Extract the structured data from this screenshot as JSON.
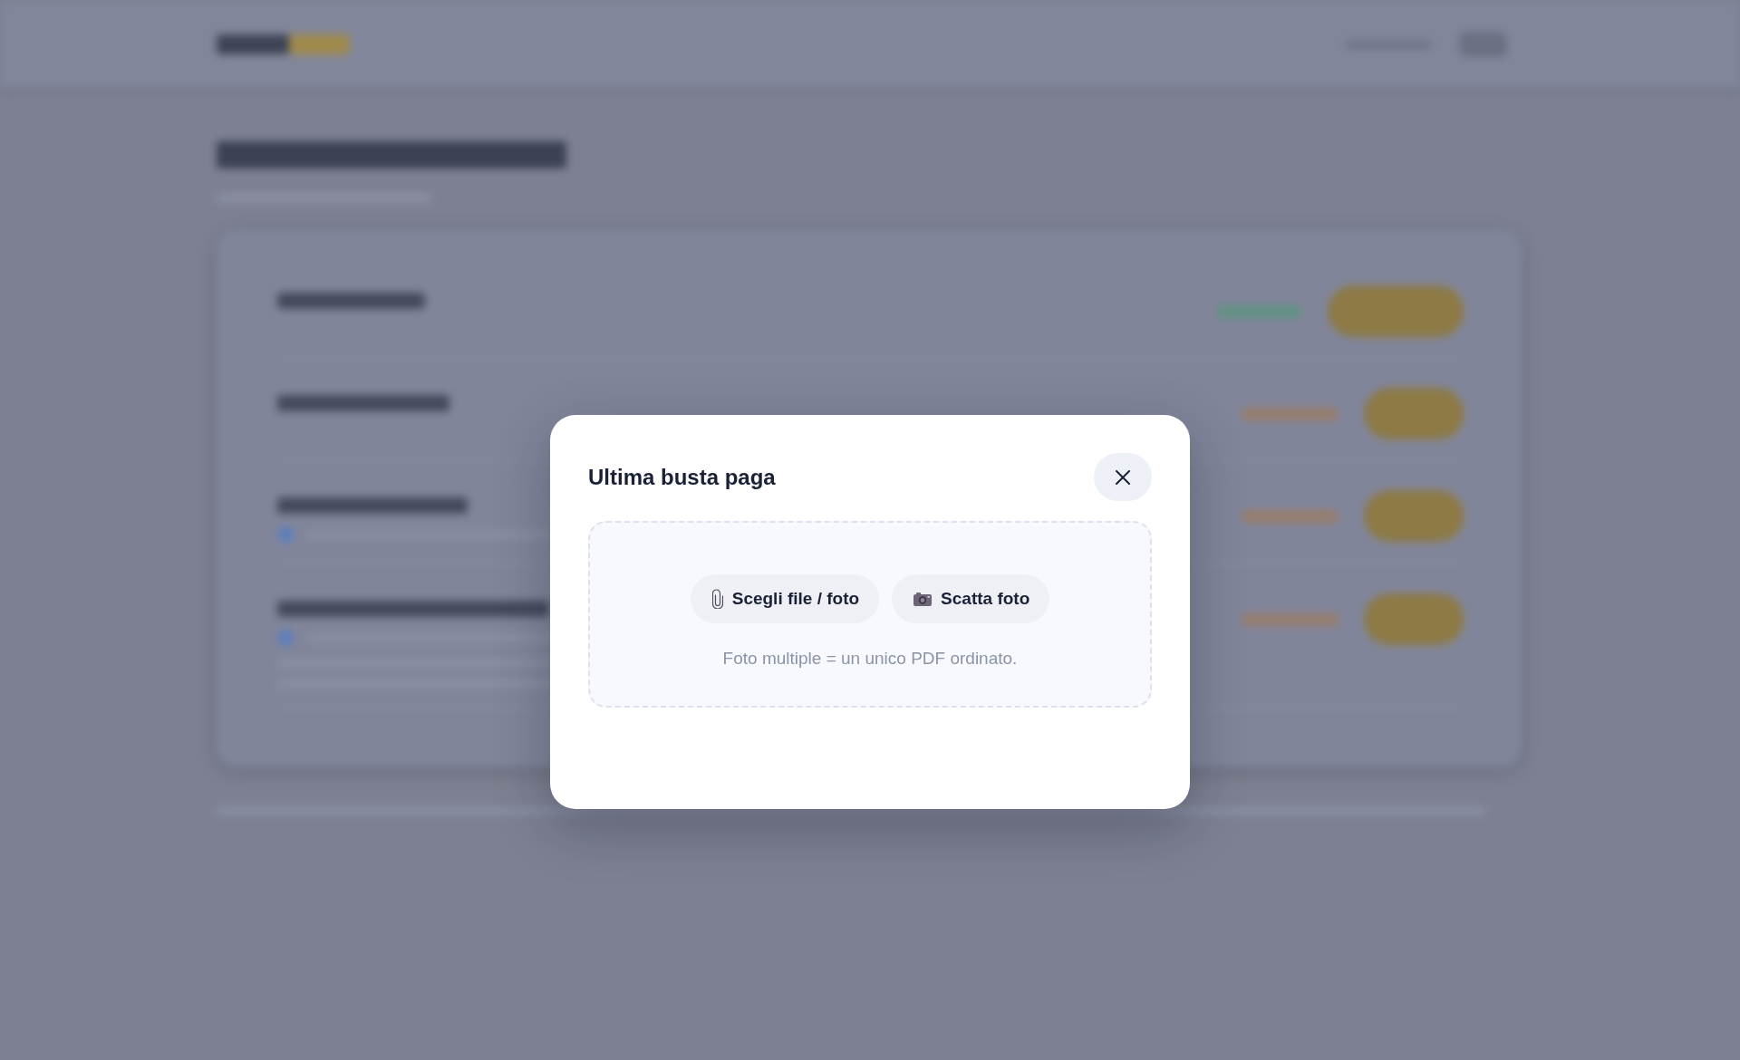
{
  "dialog": {
    "title": "Ultima busta paga",
    "upload_area": {
      "actions": [
        {
          "kind": "file",
          "label": "Scegli file / foto"
        },
        {
          "kind": "camera",
          "label": "Scatta foto"
        }
      ],
      "hint": "Foto multiple = un unico PDF ordinato."
    }
  }
}
